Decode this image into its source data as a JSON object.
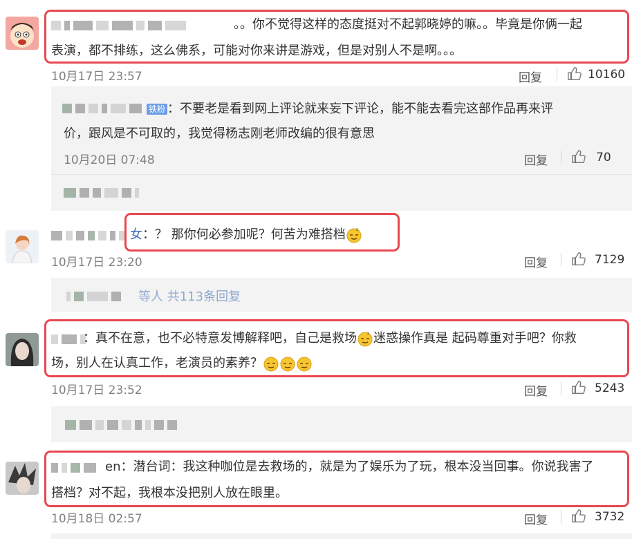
{
  "comments": [
    {
      "text_line1": "。。你不觉得这样的态度挺对不起郭晓婷的嘛。。毕竟是你俩一起",
      "text_line2": "表演，都不排练，这么佛系，可能对你来讲是游戏，但是对别人不是啊。。。",
      "time": "10月17日 23:57",
      "reply": "回复",
      "likes": "10160"
    },
    {
      "badge": "铁粉",
      "text_line1": "：不要老是看到网上评论就来妄下评论，能不能去看完这部作品再来评",
      "text_line2": "价，跟风是不可取的，我觉得杨志刚老师改编的很有意思",
      "time": "10月20日 07:48",
      "reply": "回复",
      "likes": "70"
    },
    {
      "name_tail": "女",
      "text": "：？ 那你何必参加呢？何苦为难搭档",
      "time": "10月17日 23:20",
      "reply": "回复",
      "likes": "7129"
    },
    {
      "sub_replies": "等人 共113条回复",
      "text_line1": "：真不在意，也不必特意发博解释吧，自己是救场",
      "text_line1b": "迷惑操作真是 起码尊重对手吧？你救",
      "text_line2": "场，别人在认真工作，老演员的素养？",
      "time": "10月17日 23:52",
      "reply": "回复",
      "likes": "5243"
    },
    {
      "name_tail": "en",
      "text_line1": "：潜台词：我这种咖位是去救场的，就是为了娱乐为了玩，根本没当回事。你说我害了",
      "text_line2": "搭档？对不起，我根本没把别人放在眼里。",
      "time": "10月18日 02:57",
      "reply": "回复",
      "likes": "3732"
    }
  ],
  "icons": {
    "like": "thumbs-up-icon",
    "emoji": "sleepy-face-emoji"
  },
  "colors": {
    "highlight_border": "#e8474f",
    "badge": "#6a9ee8",
    "nested_bg": "#f3f3f3"
  }
}
